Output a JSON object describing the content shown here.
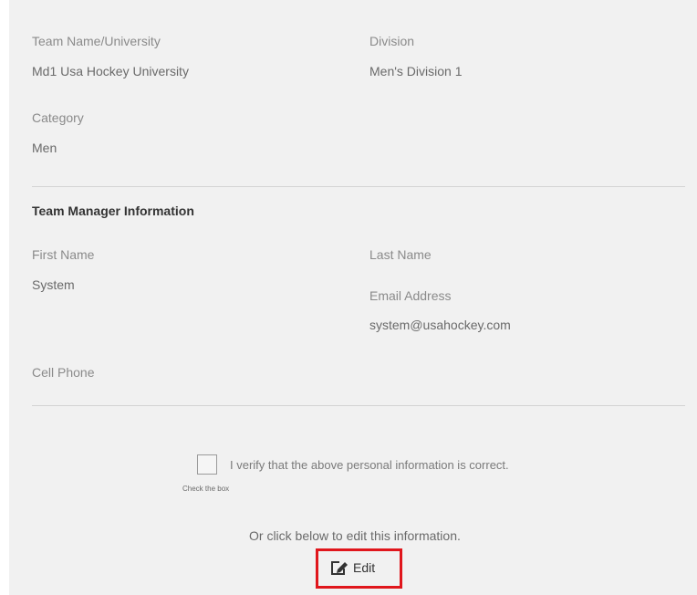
{
  "team": {
    "name_label": "Team Name/University",
    "name_value": "Md1 Usa Hockey University",
    "division_label": "Division",
    "division_value": "Men's Division 1",
    "category_label": "Category",
    "category_value": "Men"
  },
  "manager": {
    "section_title": "Team Manager Information",
    "first_name_label": "First Name",
    "first_name_value": "System",
    "last_name_label": "Last Name",
    "email_label": "Email Address",
    "email_value": "system@usahockey.com",
    "cell_phone_label": "Cell Phone"
  },
  "verify": {
    "checked": false,
    "label": "I verify that the above personal information is correct.",
    "hint": "Check the box"
  },
  "edit": {
    "prompt": "Or click below to edit this information.",
    "button_label": "Edit",
    "icon": "edit-icon",
    "highlight_color": "#e0161c"
  }
}
